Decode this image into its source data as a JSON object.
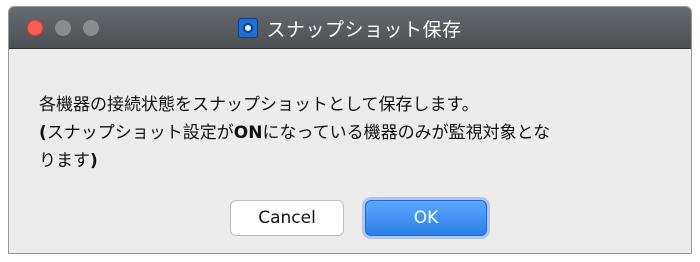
{
  "window": {
    "title": "スナップショット保存"
  },
  "message": {
    "line1": "各機器の接続状態をスナップショットとして保存します。",
    "line2_part1": "(",
    "line2_part2": "スナップショット設定が",
    "line2_part3": "ON",
    "line2_part4": "になっている機器のみが監視対象とな",
    "line3_part1": "ります",
    "line3_part2": ")"
  },
  "buttons": {
    "cancel_label": "Cancel",
    "ok_label": "OK"
  },
  "colors": {
    "titlebar": "#55595d",
    "close_button": "#fc5e56",
    "ok_button": "#2c7fe8"
  }
}
